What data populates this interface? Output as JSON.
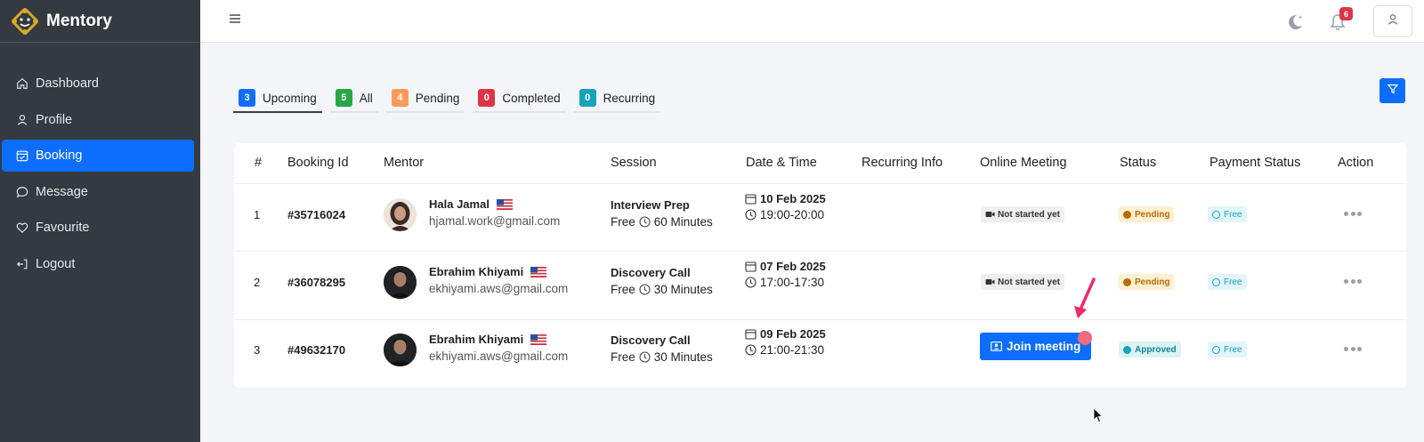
{
  "brand": {
    "name": "Mentory"
  },
  "sidebar": {
    "items": [
      {
        "label": "Dashboard",
        "icon": "home-icon",
        "active": false
      },
      {
        "label": "Profile",
        "icon": "user-icon",
        "active": false
      },
      {
        "label": "Booking",
        "icon": "calendar-check-icon",
        "active": true
      },
      {
        "label": "Message",
        "icon": "chat-icon",
        "active": false
      },
      {
        "label": "Favourite",
        "icon": "heart-icon",
        "active": false
      },
      {
        "label": "Logout",
        "icon": "logout-icon",
        "active": false
      }
    ]
  },
  "topbar": {
    "notification_count": "6"
  },
  "tabs": [
    {
      "count": "3",
      "label": "Upcoming",
      "color": "#0d6efd",
      "active": true
    },
    {
      "count": "5",
      "label": "All",
      "color": "#28a745",
      "active": false
    },
    {
      "count": "4",
      "label": "Pending",
      "color": "#fd9b5c",
      "active": false
    },
    {
      "count": "0",
      "label": "Completed",
      "color": "#dc3545",
      "active": false
    },
    {
      "count": "0",
      "label": "Recurring",
      "color": "#17a2b8",
      "active": false
    }
  ],
  "table": {
    "headers": {
      "num": "#",
      "booking_id": "Booking Id",
      "mentor": "Mentor",
      "session": "Session",
      "datetime": "Date & Time",
      "recurring": "Recurring Info",
      "meeting": "Online Meeting",
      "status": "Status",
      "payment": "Payment Status",
      "action": "Action"
    },
    "rows": [
      {
        "num": "1",
        "booking_id": "#35716024",
        "mentor_name": "Hala Jamal",
        "mentor_email": "hjamal.work@gmail.com",
        "session_title": "Interview Prep",
        "session_price": "Free",
        "session_duration": "60 Minutes",
        "date": "10 Feb 2025",
        "time": "19:00-20:00",
        "meeting": "Not started yet",
        "status": "Pending",
        "payment": "Free"
      },
      {
        "num": "2",
        "booking_id": "#36078295",
        "mentor_name": "Ebrahim Khiyami",
        "mentor_email": "ekhiyami.aws@gmail.com",
        "session_title": "Discovery Call",
        "session_price": "Free",
        "session_duration": "30 Minutes",
        "date": "07 Feb 2025",
        "time": "17:00-17:30",
        "meeting": "Not started yet",
        "status": "Pending",
        "payment": "Free"
      },
      {
        "num": "3",
        "booking_id": "#49632170",
        "mentor_name": "Ebrahim Khiyami",
        "mentor_email": "ekhiyami.aws@gmail.com",
        "session_title": "Discovery Call",
        "session_price": "Free",
        "session_duration": "30 Minutes",
        "date": "09 Feb 2025",
        "time": "21:00-21:30",
        "meeting_button": "Join meeting",
        "status": "Approved",
        "payment": "Free"
      }
    ]
  }
}
